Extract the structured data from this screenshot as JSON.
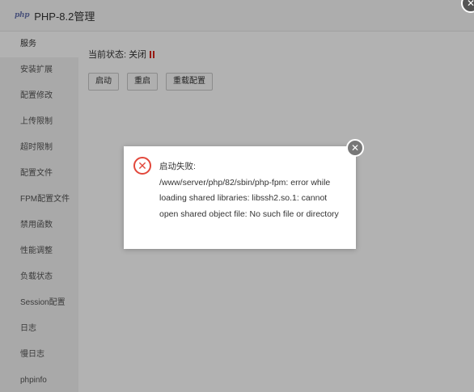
{
  "window": {
    "logo_text": "php",
    "title": "PHP-8.2管理",
    "close_glyph": "✕"
  },
  "sidebar": {
    "items": [
      {
        "label": "服务",
        "active": true
      },
      {
        "label": "安装扩展"
      },
      {
        "label": "配置修改"
      },
      {
        "label": "上传限制"
      },
      {
        "label": "超时限制"
      },
      {
        "label": "配置文件"
      },
      {
        "label": "FPM配置文件"
      },
      {
        "label": "禁用函数"
      },
      {
        "label": "性能调整"
      },
      {
        "label": "负载状态"
      },
      {
        "label": "Session配置"
      },
      {
        "label": "日志"
      },
      {
        "label": "慢日志"
      },
      {
        "label": "phpinfo"
      }
    ]
  },
  "service": {
    "status_label": "当前状态:",
    "status_value": "关闭",
    "status_color": "#d9261c",
    "buttons": {
      "start": "启动",
      "restart": "重启",
      "reload": "重载配置"
    }
  },
  "dialog": {
    "icon": "error-icon",
    "message": "启动失败:\n/www/server/php/82/sbin/php-fpm: error while loading shared libraries: libssh2.so.1: cannot open shared object file: No such file or directory",
    "close_glyph": "✕"
  }
}
